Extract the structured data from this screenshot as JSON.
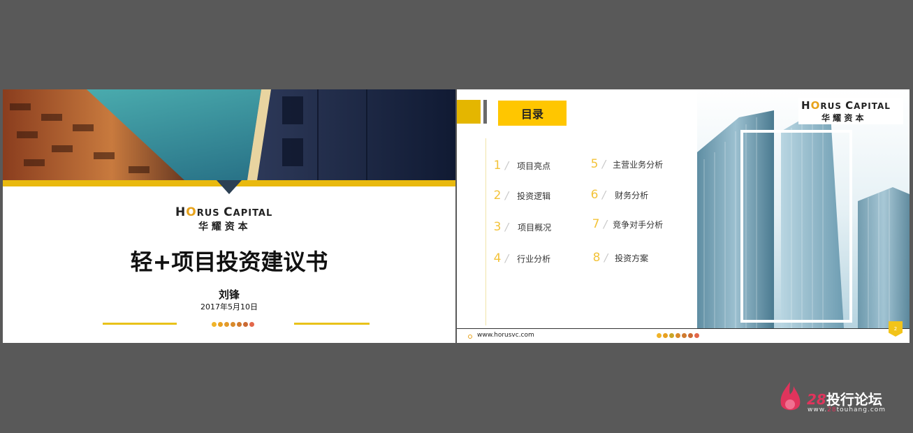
{
  "slide1": {
    "logo_en_prefix": "H",
    "logo_en_o": "O",
    "logo_en_rest1": "RUS ",
    "logo_en_c": "C",
    "logo_en_rest2": "APITAL",
    "logo_cn": "华 耀 资 本",
    "title": "轻+项目投资建议书",
    "author": "刘锋",
    "date": "2017年5月10日",
    "dot_colors": [
      "#f0b429",
      "#e8a020",
      "#e39a2a",
      "#d98a2a",
      "#d07a2e",
      "#cb6a33",
      "#e3674a"
    ]
  },
  "slide2": {
    "heading": "目录",
    "logo_en_prefix": "H",
    "logo_en_o": "O",
    "logo_en_rest1": "RUS ",
    "logo_en_c": "C",
    "logo_en_rest2": "APITAL",
    "logo_cn": "华 耀 资 本",
    "toc": [
      {
        "num": "1",
        "label": "项目亮点"
      },
      {
        "num": "2",
        "label": "投资逻辑"
      },
      {
        "num": "3",
        "label": "项目概况"
      },
      {
        "num": "4",
        "label": "行业分析"
      },
      {
        "num": "5",
        "label": "主营业务分析"
      },
      {
        "num": "6",
        "label": "财务分析"
      },
      {
        "num": "7",
        "label": "竞争对手分析"
      },
      {
        "num": "8",
        "label": "投资方案"
      }
    ],
    "url": "www.horusvc.com",
    "page_number": "2",
    "dot_colors": [
      "#f0b429",
      "#e8a020",
      "#c9a526",
      "#d98a2a",
      "#d07a2e",
      "#cb6a33",
      "#e3674a"
    ]
  },
  "watermark": {
    "num": "28",
    "text": "投行论坛",
    "url_prefix": "www.",
    "url_hl": "28",
    "url_suffix": "touhang.com"
  },
  "colors": {
    "background": "#595959",
    "accent_yellow": "#e9b90e",
    "logo_orange": "#e7a21a",
    "watermark_red": "#e0345c"
  }
}
